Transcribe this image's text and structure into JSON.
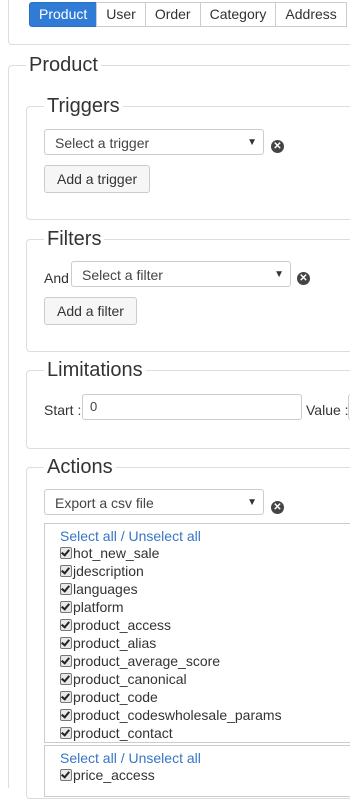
{
  "tabs": [
    "Product",
    "User",
    "Order",
    "Category",
    "Address"
  ],
  "section_title": "Product",
  "triggers": {
    "legend": "Triggers",
    "select_value": "Select a trigger",
    "add_button": "Add a trigger"
  },
  "filters": {
    "legend": "Filters",
    "and_label": "And",
    "select_value": "Select a filter",
    "add_button": "Add a filter"
  },
  "limitations": {
    "legend": "Limitations",
    "start_label": "Start :",
    "start_value": "0",
    "value_label": "Value :"
  },
  "actions": {
    "legend": "Actions",
    "select_value": "Export a csv file",
    "select_all": "Select all",
    "separator": "/",
    "unselect_all": "Unselect all",
    "product_columns": [
      "hot_new_sale",
      "jdescription",
      "languages",
      "platform",
      "product_access",
      "product_alias",
      "product_average_score",
      "product_canonical",
      "product_code",
      "product_codeswholesale_params",
      "product_contact"
    ],
    "price_columns": [
      "price_access"
    ]
  },
  "icons": {
    "remove": "x-circle-icon",
    "dropdown": "caret-down-icon",
    "checkbox": "checkmark-icon"
  },
  "colors": {
    "active_tab": "#2f7bd6",
    "link": "#3576c6"
  }
}
